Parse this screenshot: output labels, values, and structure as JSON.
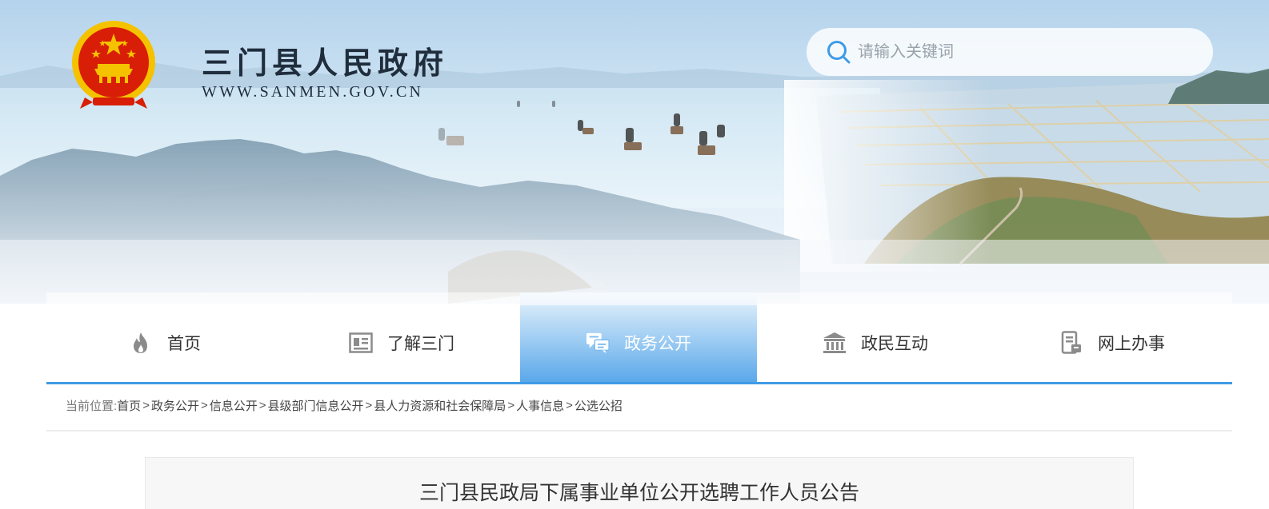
{
  "header": {
    "site_title": "三门县人民政府",
    "site_url": "WWW.SANMEN.GOV.CN",
    "emblem_icon": "national-emblem-icon"
  },
  "search": {
    "placeholder": "请输入关键词",
    "value": "",
    "icon": "search-icon"
  },
  "nav": {
    "items": [
      {
        "label": "首页",
        "icon": "flame-icon",
        "active": false
      },
      {
        "label": "了解三门",
        "icon": "newspaper-icon",
        "active": false
      },
      {
        "label": "政务公开",
        "icon": "chat-bubbles-icon",
        "active": true
      },
      {
        "label": "政民互动",
        "icon": "government-building-icon",
        "active": false
      },
      {
        "label": "网上办事",
        "icon": "document-printer-icon",
        "active": false
      }
    ]
  },
  "breadcrumb": {
    "prefix": "当前位置:",
    "separator": ">",
    "items": [
      "首页",
      "政务公开",
      "信息公开",
      "县级部门信息公开",
      "县人力资源和社会保障局",
      "人事信息",
      "公选公招"
    ]
  },
  "article": {
    "title": "三门县民政局下属事业单位公开选聘工作人员公告"
  },
  "colors": {
    "accent": "#3e9be6",
    "nav_active_top": "#eaf4fc",
    "nav_active_bottom": "#5aa8ea",
    "emblem_red": "#d81e06",
    "emblem_gold": "#f5c200"
  }
}
